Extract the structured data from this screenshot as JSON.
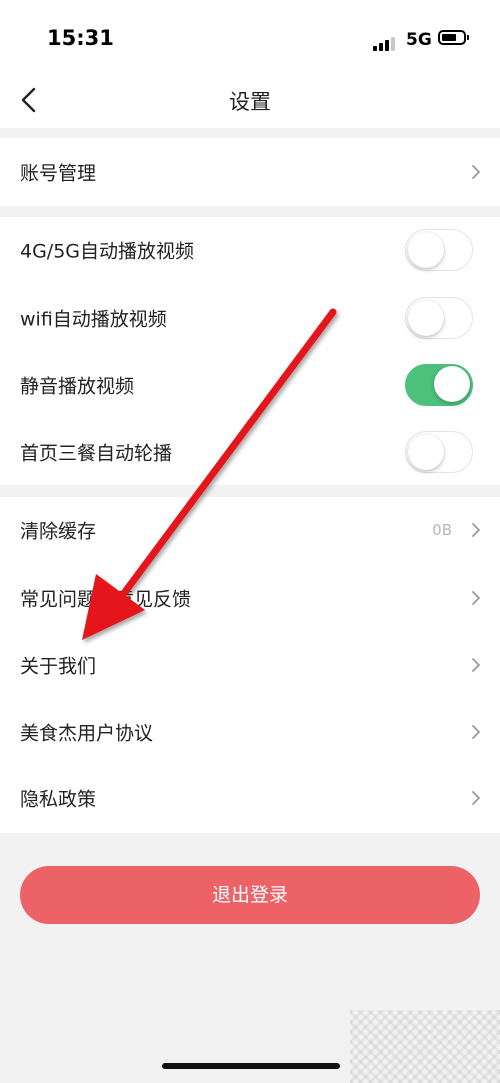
{
  "status_bar": {
    "time": "15:31",
    "network": "5G"
  },
  "nav": {
    "title": "设置"
  },
  "account_group": {
    "items": [
      {
        "label": "账号管理"
      }
    ]
  },
  "playback_group": {
    "items": [
      {
        "label": "4G/5G自动播放视频",
        "enabled": false
      },
      {
        "label": "wifi自动播放视频",
        "enabled": false
      },
      {
        "label": "静音播放视频",
        "enabled": true
      },
      {
        "label": "首页三餐自动轮播",
        "enabled": false
      }
    ]
  },
  "misc_group": {
    "items": [
      {
        "label": "清除缓存",
        "value": "0B"
      },
      {
        "label": "常见问题与意见反馈"
      },
      {
        "label": "关于我们"
      },
      {
        "label": "美食杰用户协议"
      },
      {
        "label": "隐私政策"
      }
    ]
  },
  "logout_button": {
    "label": "退出登录"
  },
  "colors": {
    "toggle_on": "#4cc17c",
    "logout": "#ec6266",
    "annotation_arrow": "#e4161c"
  }
}
